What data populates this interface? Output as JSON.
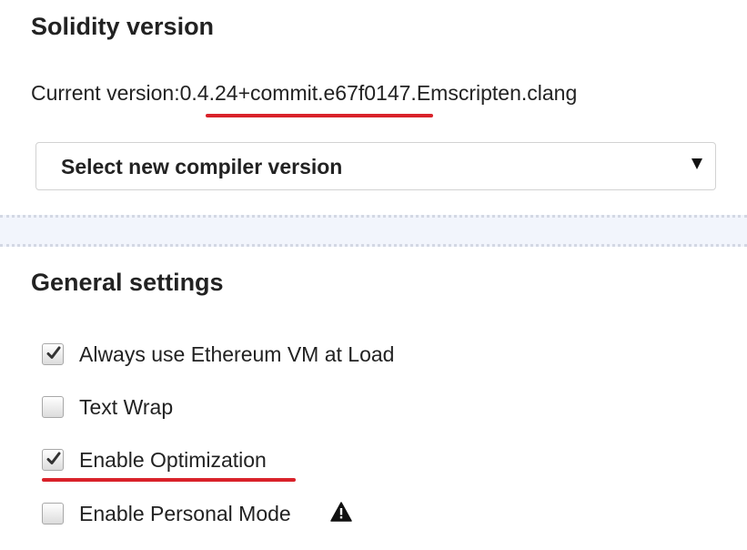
{
  "solidity": {
    "title": "Solidity version",
    "current_version_label": "Current version:",
    "current_version_value": "0.4.24+commit.e67f0147.Emscripten.clang",
    "select_label": "Select new compiler version",
    "highlight_color": "#d9222a"
  },
  "general": {
    "title": "General settings",
    "settings": [
      {
        "label": "Always use Ethereum VM at Load",
        "checked": true
      },
      {
        "label": "Text Wrap",
        "checked": false
      },
      {
        "label": "Enable Optimization",
        "checked": true
      },
      {
        "label": "Enable Personal Mode",
        "checked": false,
        "icon": "warning-icon"
      }
    ]
  }
}
